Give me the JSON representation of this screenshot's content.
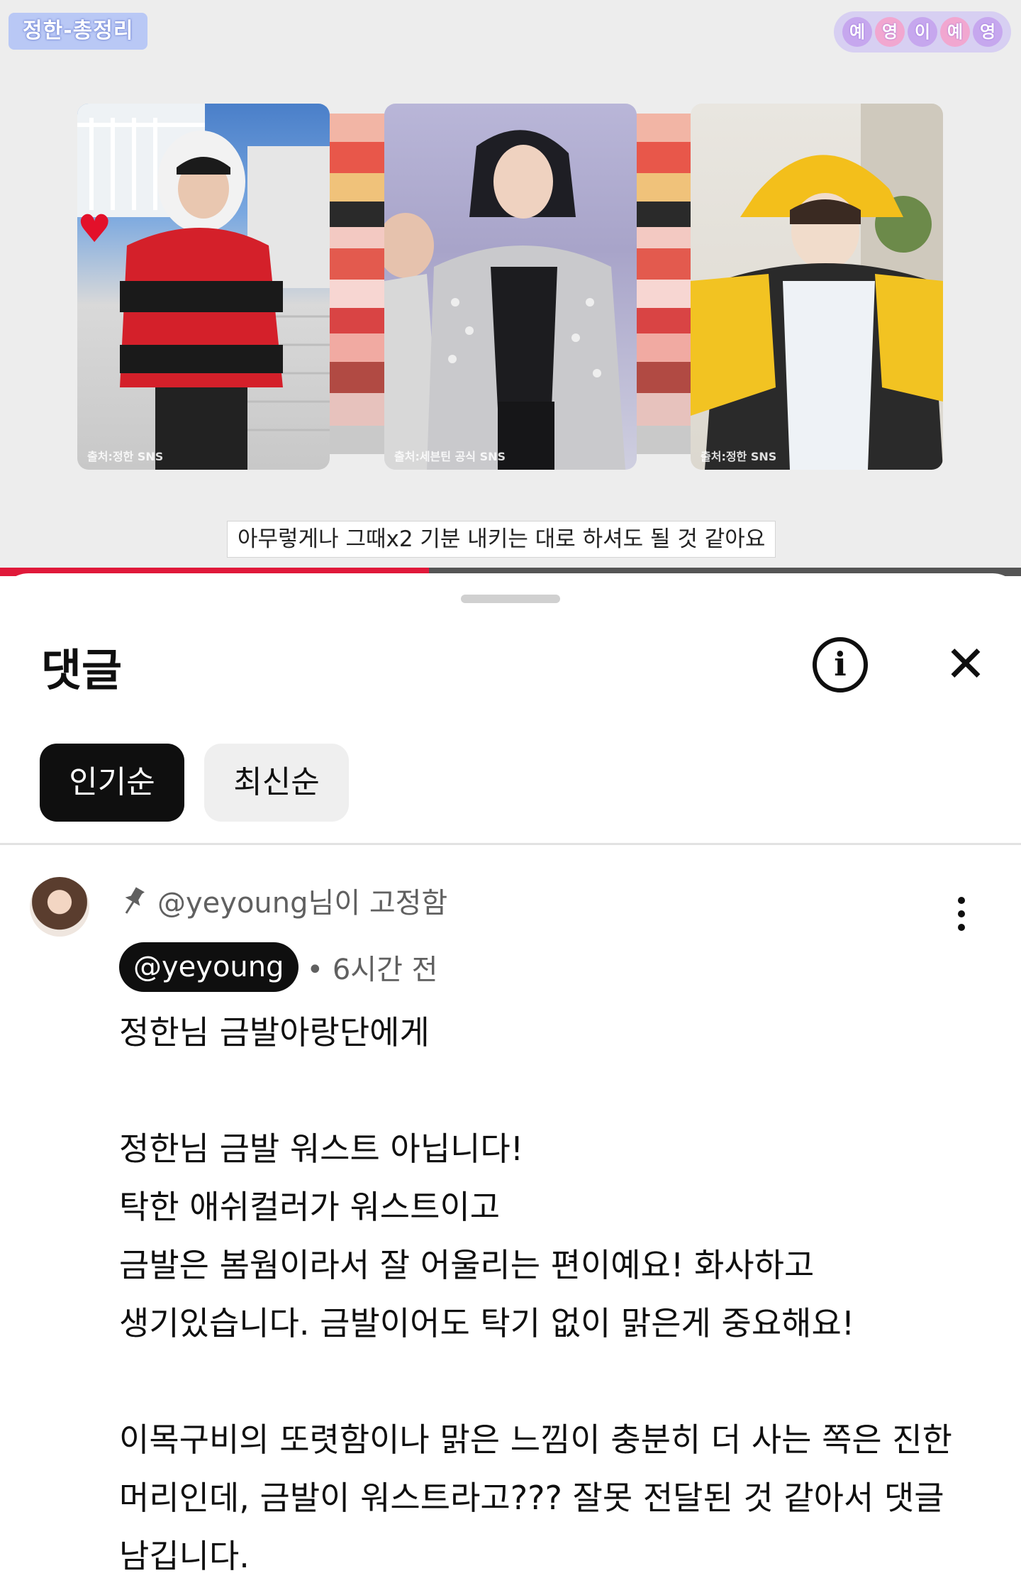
{
  "video": {
    "channel_badge": "정한-총정리",
    "creator_badge": [
      "예",
      "영",
      "이",
      "예",
      "영"
    ],
    "photo_credits": [
      "출처:정한 SNS",
      "출처:세븐틴 공식 SNS",
      "출처:정한 SNS"
    ],
    "subtitle": "아무렇게나 그때x2 기분 내키는 대로 하셔도 될 것 같아요",
    "progress": 0.42
  },
  "comments": {
    "title": "댓글",
    "sort_tabs": [
      "인기순",
      "최신순"
    ],
    "active_tab": 0,
    "pinned_comment": {
      "pinned_label": "@yeyoung님이 고정함",
      "author": "@yeyoung",
      "time": "• 6시간 전",
      "lines": [
        "정한님 금발아랑단에게",
        "",
        "정한님 금발 워스트 아닙니다!",
        "탁한 애쉬컬러가 워스트이고",
        "금발은 봄웜이라서 잘 어울리는 편이예요! 화사하고",
        "생기있습니다. 금발이어도 탁기 없이 맑은게 중요해요!",
        "",
        "이목구비의 또렷함이나 맑은 느낌이 충분히 더 사는 쪽은 진한",
        "머리인데, 금발이 워스트라고??? 잘못 전달된 것 같아서 댓글",
        "남깁니다."
      ]
    }
  },
  "colors": {
    "progress": "#e0193a",
    "chip_active_bg": "#0f0f0f",
    "chip_idle_bg": "#efefef",
    "badge_left_bg": "#b9c8f5"
  },
  "icons": [
    "info-icon",
    "close-icon",
    "pin-icon",
    "more-vert-icon",
    "heart-icon"
  ]
}
